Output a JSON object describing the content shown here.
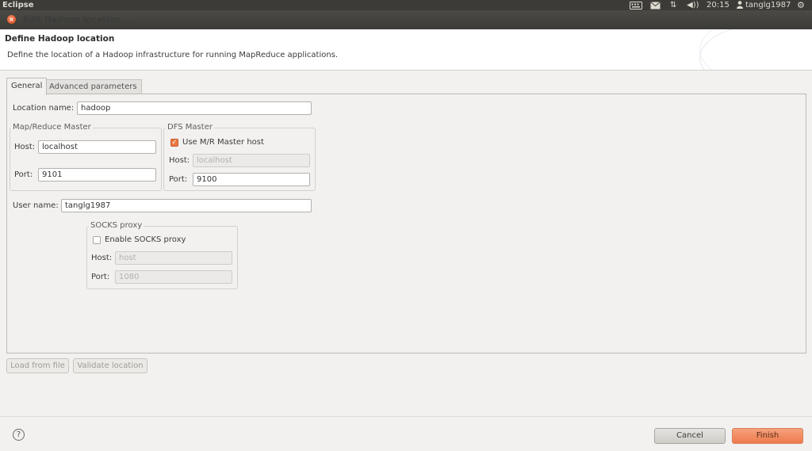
{
  "top_panel": {
    "app_name": "Eclipse",
    "time": "20:15",
    "user": "tanglg1987",
    "icons": [
      "keyboard-icon",
      "mail-icon",
      "network-icon",
      "volume-icon",
      "user-icon",
      "gear-icon"
    ]
  },
  "window": {
    "title": "Edit Hadoop location..."
  },
  "header": {
    "title": "Define Hadoop location",
    "description": "Define the location of a Hadoop infrastructure for running MapReduce applications."
  },
  "tabs": [
    {
      "label": "General",
      "active": true
    },
    {
      "label": "Advanced parameters",
      "active": false
    }
  ],
  "general": {
    "location_name_label": "Location name:",
    "location_name_value": "hadoop",
    "mr_master": {
      "title": "Map/Reduce Master",
      "host_label": "Host:",
      "host_value": "localhost",
      "port_label": "Port:",
      "port_value": "9101"
    },
    "dfs_master": {
      "title": "DFS Master",
      "use_mr_label": "Use M/R Master host",
      "use_mr_checked": true,
      "host_label": "Host:",
      "host_value": "localhost",
      "port_label": "Port:",
      "port_value": "9100"
    },
    "user_name_label": "User name:",
    "user_name_value": "tanglg1987",
    "socks": {
      "title": "SOCKS proxy",
      "enable_label": "Enable SOCKS proxy",
      "enabled": false,
      "host_label": "Host:",
      "host_value": "host",
      "port_label": "Port:",
      "port_value": "1080"
    }
  },
  "buttons": {
    "load_from_file": "Load from file",
    "validate_location": "Validate location",
    "cancel": "Cancel",
    "finish": "Finish",
    "help": "?"
  },
  "colors": {
    "accent": "#ee7a4d",
    "panel": "#3c3b37",
    "background": "#f2f1f0"
  }
}
